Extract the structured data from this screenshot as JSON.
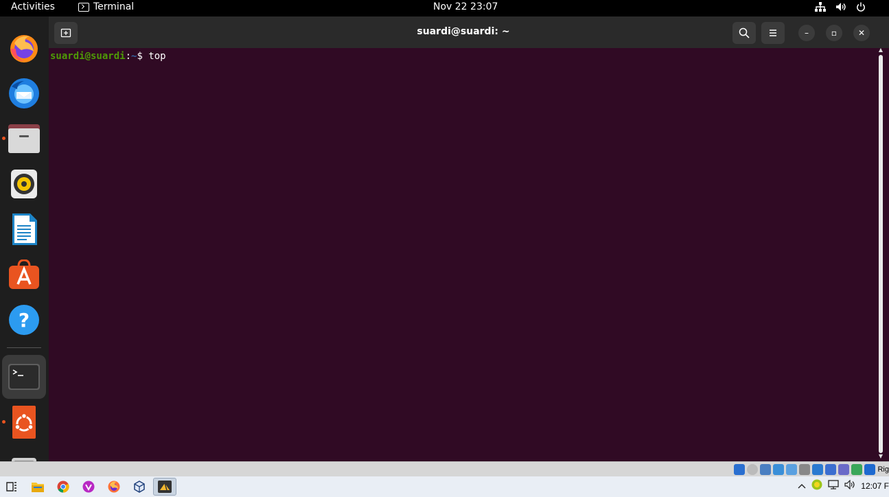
{
  "topbar": {
    "activities": "Activities",
    "app_name": "Terminal",
    "clock": "Nov 22  23:07",
    "tray_icons": [
      "network-icon",
      "volume-icon",
      "power-icon"
    ]
  },
  "dock": {
    "items": [
      {
        "name": "firefox",
        "running": false
      },
      {
        "name": "thunderbird",
        "running": false
      },
      {
        "name": "files",
        "running": true
      },
      {
        "name": "rhythmbox",
        "running": false
      },
      {
        "name": "libreoffice-writer",
        "running": false
      },
      {
        "name": "app-center",
        "running": false
      },
      {
        "name": "help",
        "running": false
      },
      {
        "name": "terminal",
        "running": true,
        "active": true
      },
      {
        "name": "ubuntu-installer",
        "running": true
      },
      {
        "name": "disk-drive",
        "running": false
      }
    ]
  },
  "window": {
    "title": "suardi@suardi: ~",
    "new_tab_icon": "new-tab-icon",
    "search_icon": "search-icon",
    "menu_icon": "hamburger-menu-icon",
    "minimize_label": "–",
    "maximize_label": "▫",
    "close_label": "✕"
  },
  "terminal": {
    "prompt_user": "suardi@suardi",
    "prompt_sep": ":",
    "prompt_path": "~",
    "prompt_symbol": "$ ",
    "command": "top"
  },
  "vbox_status": {
    "host_key": "Rig"
  },
  "taskbar": {
    "apps": [
      "task-view-icon",
      "file-explorer-icon",
      "chrome-icon",
      "brave-icon",
      "firefox-icon",
      "virtualbox-icon",
      "virtualbox-vm-icon"
    ],
    "clock": "12:07 F"
  },
  "colors": {
    "terminal_bg": "#300a24",
    "prompt_user": "#4e9a06",
    "prompt_path": "#3465a4",
    "accent": "#e95420"
  }
}
